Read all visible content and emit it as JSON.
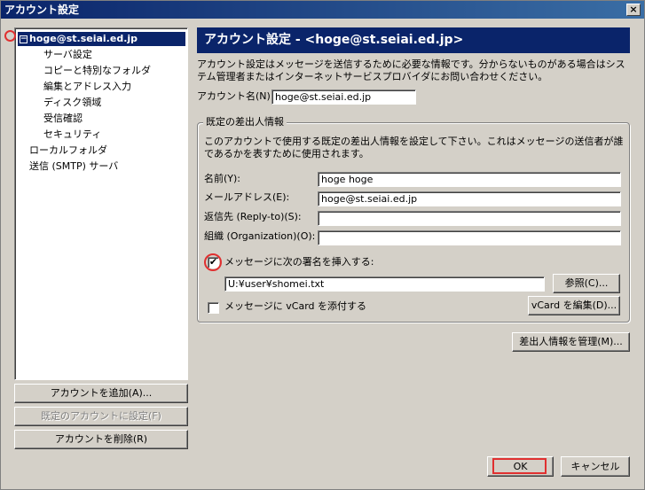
{
  "window": {
    "title": "アカウント設定",
    "close_glyph": "×"
  },
  "tree": {
    "root": "hoge@st.seiai.ed.jp",
    "root_toggle": "−",
    "children": [
      "サーバ設定",
      "コピーと特別なフォルダ",
      "編集とアドレス入力",
      "ディスク領域",
      "受信確認",
      "セキュリティ"
    ],
    "others": [
      "ローカルフォルダ",
      "送信 (SMTP) サーバ"
    ]
  },
  "left_buttons": {
    "add": "アカウントを追加(A)...",
    "set_default": "既定のアカウントに設定(F)",
    "remove": "アカウントを削除(R)"
  },
  "header": {
    "title": "アカウント設定 - <hoge@st.seiai.ed.jp>"
  },
  "description": "アカウント設定はメッセージを送信するために必要な情報です。分からないものがある場合はシステム管理者またはインターネットサービスプロバイダにお問い合わせください。",
  "account_name": {
    "label": "アカウント名(N):",
    "value": "hoge@st.seiai.ed.jp"
  },
  "identity": {
    "title": "既定の差出人情報",
    "description": "このアカウントで使用する既定の差出人情報を設定して下さい。これはメッセージの送信者が誰であるかを表すために使用されます。",
    "name": {
      "label": "名前(Y):",
      "value": "hoge hoge"
    },
    "email": {
      "label": "メールアドレス(E):",
      "value": "hoge@st.seiai.ed.jp"
    },
    "reply_to": {
      "label": "返信先 (Reply-to)(S):",
      "value": ""
    },
    "organization": {
      "label": "組織 (Organization)(O):",
      "value": ""
    },
    "signature_check": {
      "label": "メッセージに次の署名を挿入する:",
      "checked_glyph": "✔"
    },
    "signature_path": "U:¥user¥shomei.txt",
    "browse_button": "参照(C)...",
    "vcard_check": {
      "label": "メッセージに vCard を添付する",
      "checked_glyph": ""
    },
    "vcard_button": "vCard を編集(D)..."
  },
  "manage_button": "差出人情報を管理(M)...",
  "footer": {
    "ok": "OK",
    "cancel": "キャンセル"
  }
}
